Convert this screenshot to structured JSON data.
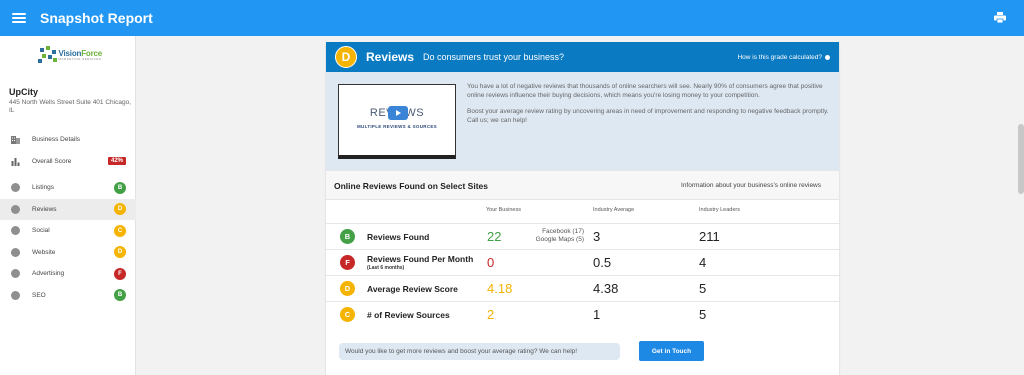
{
  "app": {
    "title": "Snapshot Report"
  },
  "sidebar": {
    "logo": {
      "name_part1": "Vision",
      "name_part2": "Force",
      "tagline": "MARKETING SERVICES"
    },
    "business": {
      "name": "UpCity",
      "address": "445 North Wells Street Suite 401 Chicago, IL"
    },
    "items": [
      {
        "label": "Business Details",
        "icon": "building-icon"
      },
      {
        "label": "Overall Score",
        "icon": "bar-chart-icon",
        "score": "42%"
      },
      {
        "label": "Listings",
        "icon": "listings-icon",
        "grade": "B",
        "grade_color": "#43a047"
      },
      {
        "label": "Reviews",
        "icon": "star-icon",
        "grade": "D",
        "grade_color": "#f4b400",
        "active": true
      },
      {
        "label": "Social",
        "icon": "social-icon",
        "grade": "C",
        "grade_color": "#f4b400"
      },
      {
        "label": "Website",
        "icon": "globe-icon",
        "grade": "D",
        "grade_color": "#f4b400"
      },
      {
        "label": "Advertising",
        "icon": "megaphone-icon",
        "grade": "F",
        "grade_color": "#c62828"
      },
      {
        "label": "SEO",
        "icon": "search-icon",
        "grade": "B",
        "grade_color": "#43a047"
      }
    ]
  },
  "card": {
    "grade": "D",
    "title": "Reviews",
    "question": "Do consumers trust your business?",
    "grade_calc_link": "How is this grade calculated?",
    "video": {
      "title": "REVIEWS",
      "subtitle": "MULTIPLE REVIEWS & SOURCES"
    },
    "intro_p1": "You have a lot of negative reviews that thousands of online searchers will see. Nearly 90% of consumers agree that positive online reviews influence their buying decisions, which means you're losing money to your competition.",
    "intro_p2": "Boost your average review rating by uncovering areas in need of improvement and responding to negative feedback promptly. Call us; we can help!",
    "section_title": "Online Reviews Found on Select Sites",
    "section_info": "Information about your business's online reviews",
    "columns": {
      "yours": "Your Business",
      "industry": "Industry Average",
      "leaders": "Industry Leaders"
    },
    "rows": [
      {
        "grade": "B",
        "grade_color": "#43a047",
        "label": "Reviews Found",
        "value": "22",
        "value_color": "#43a047",
        "source1": "Facebook (17)",
        "source2": "Google Maps (5)",
        "industry": "3",
        "leaders": "211"
      },
      {
        "grade": "F",
        "grade_color": "#c62828",
        "label": "Reviews Found Per Month",
        "sub": "(Last 6 months)",
        "value": "0",
        "value_color": "#c62828",
        "industry": "0.5",
        "leaders": "4"
      },
      {
        "grade": "D",
        "grade_color": "#f4b400",
        "label": "Average Review Score",
        "value": "4.18",
        "value_color": "#f4b400",
        "industry": "4.38",
        "leaders": "5"
      },
      {
        "grade": "C",
        "grade_color": "#f4b400",
        "label": "# of Review Sources",
        "value": "2",
        "value_color": "#f4b400",
        "industry": "1",
        "leaders": "5"
      }
    ],
    "cta_text": "Would you like to get more reviews and boost your average rating? We can help!",
    "cta_button": "Get in Touch"
  }
}
